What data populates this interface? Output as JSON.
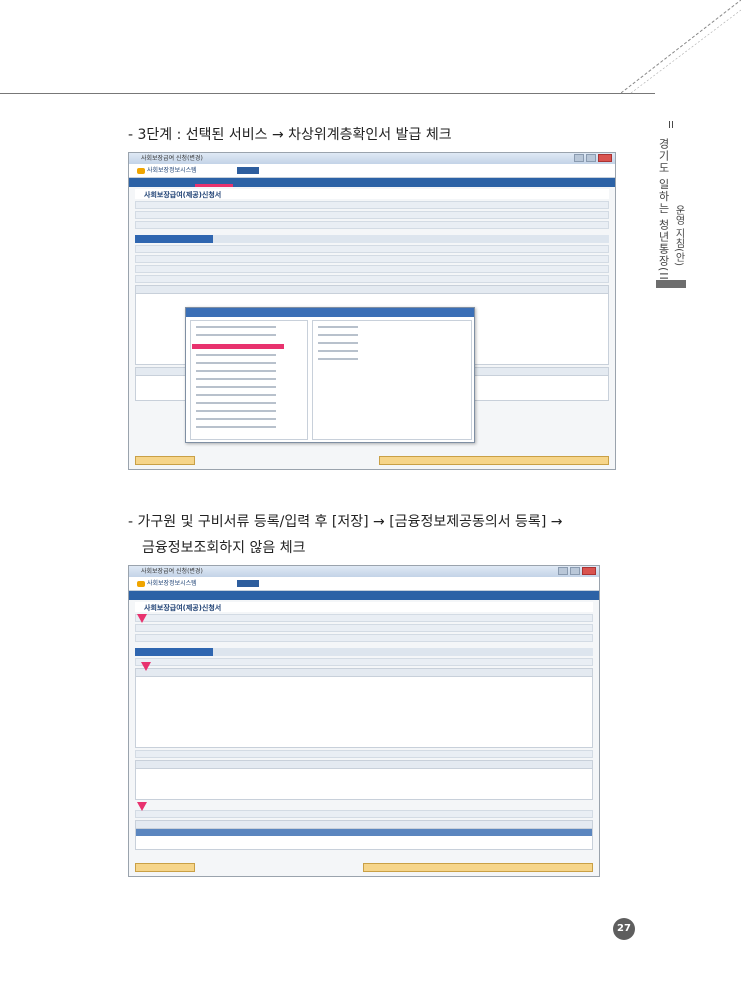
{
  "side_tab": {
    "number": "II",
    "label": "경기도 일하는 청년통장(II)",
    "sub": "운영 지침(안)"
  },
  "steps": {
    "step1": "- 3단계 : 선택된 서비스 → 차상위계층확인서 발급 체크",
    "step2_line1": "- 가구원 및 구비서류 등록/입력 후 [저장] → [금융정보제공동의서 등록] →",
    "step2_line2": "금융정보조회하지 않음 체크"
  },
  "screenshots": {
    "shot1": {
      "window_title": "사회보장급여 신청(변경)",
      "app_name": "사회보장정보시스템",
      "form_title": "사회보장급여(제공)신청서"
    },
    "shot2": {
      "window_title": "사회보장급여 신청(변경)",
      "app_name": "사회보장정보시스템",
      "form_title": "사회보장급여(제공)신청서"
    }
  },
  "colors": {
    "accent_pink": "#e8326e",
    "menu_blue": "#2c62a6",
    "button_gold": "#f6d58a"
  },
  "page_number": "27"
}
